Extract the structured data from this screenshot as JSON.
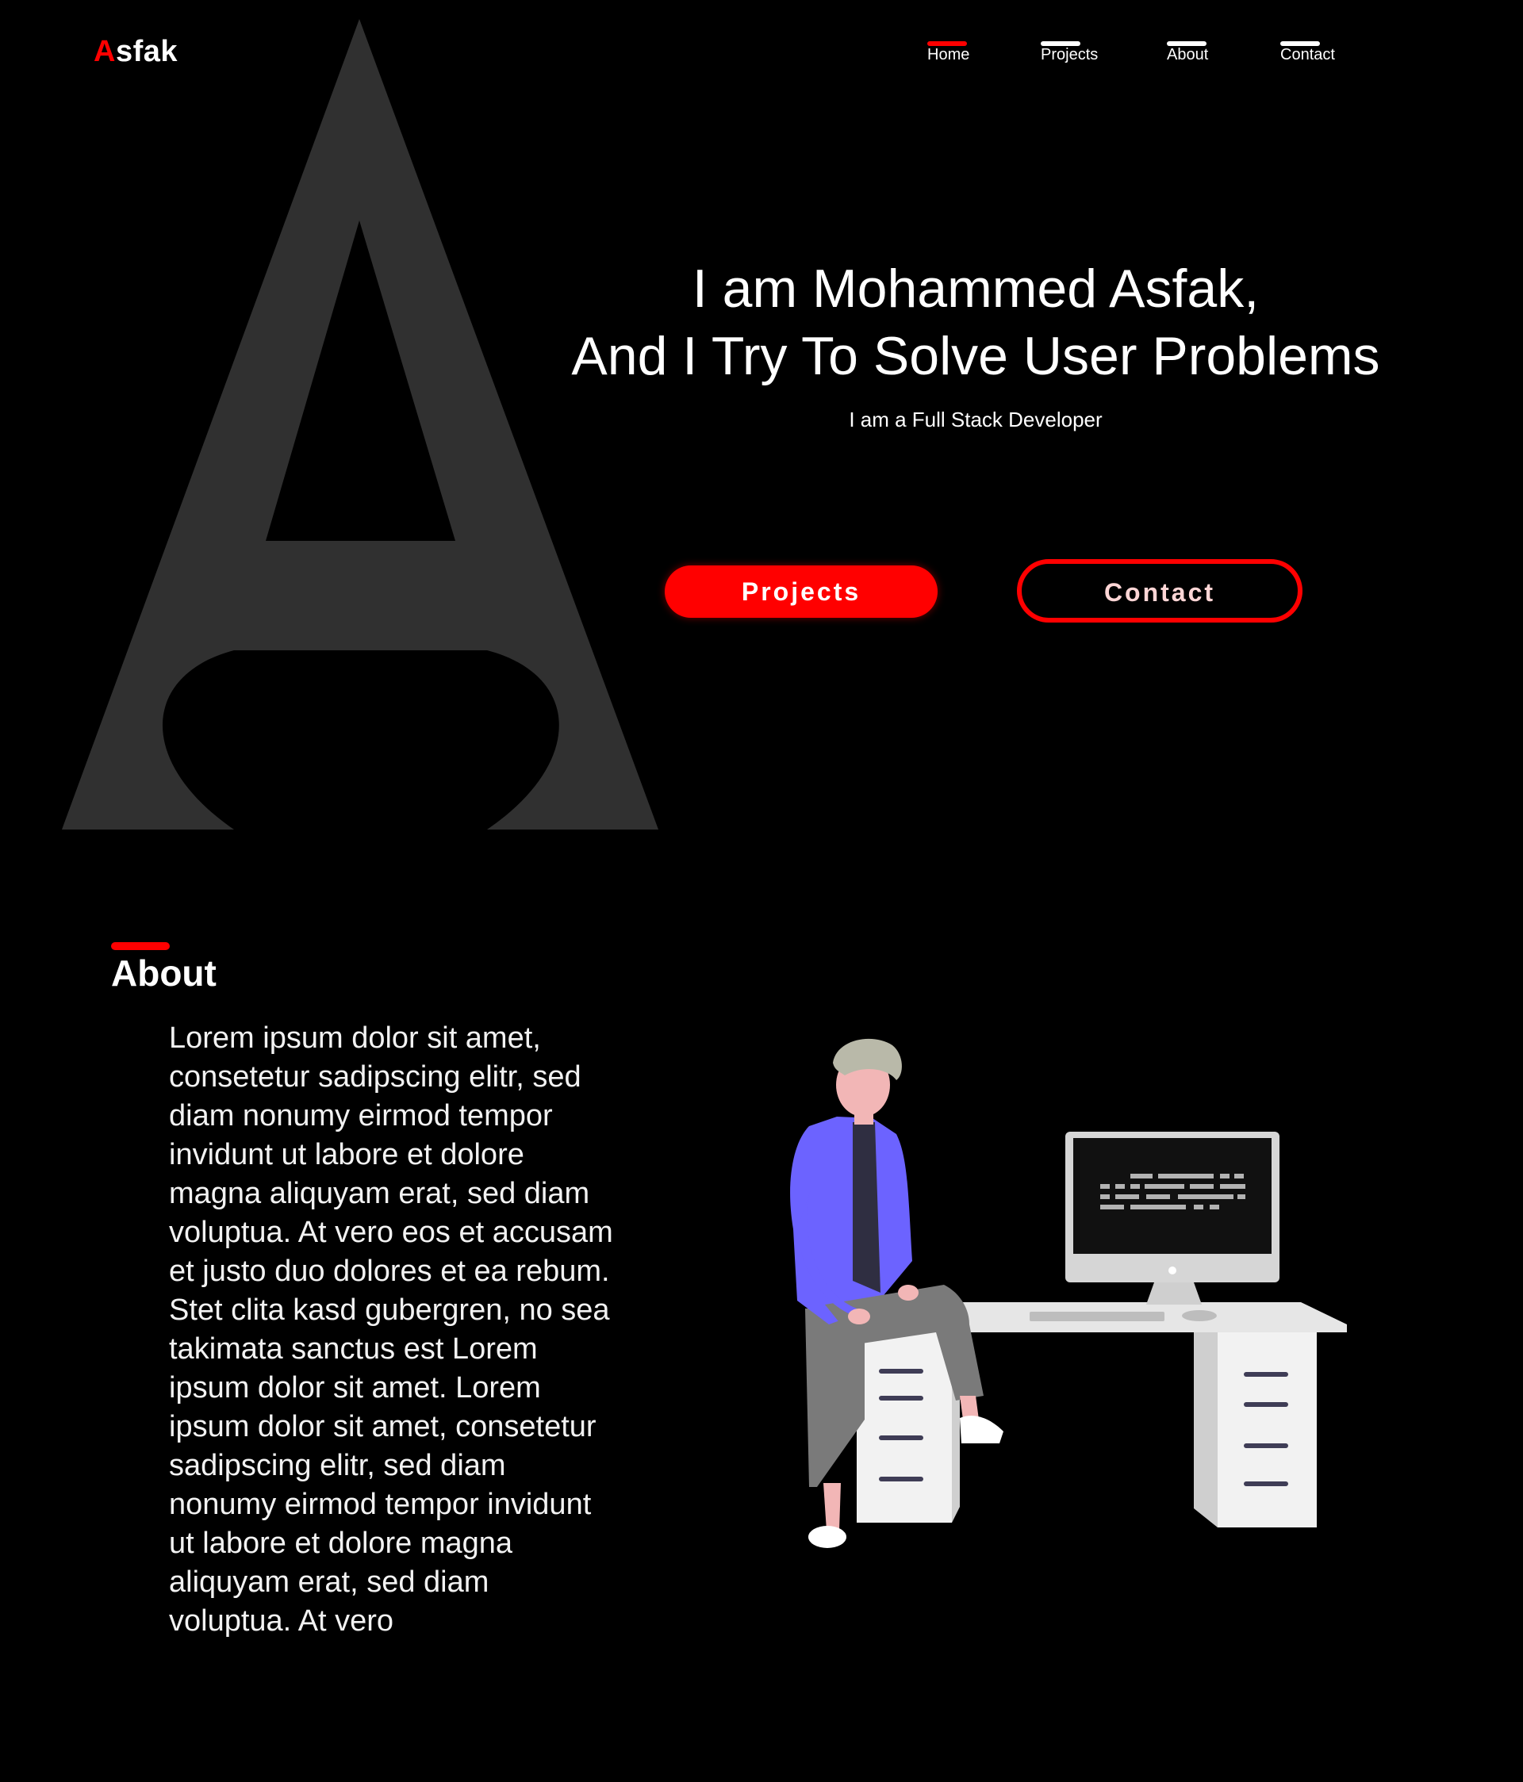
{
  "logo": {
    "accent": "A",
    "rest": "sfak"
  },
  "nav": {
    "items": [
      {
        "label": "Home",
        "active": true
      },
      {
        "label": "Projects",
        "active": false
      },
      {
        "label": "About",
        "active": false
      },
      {
        "label": "Contact",
        "active": false
      }
    ]
  },
  "hero": {
    "line1": "I am Mohammed Asfak,",
    "line2": "And I Try To Solve User Problems",
    "subtitle": "I am a Full Stack Developer",
    "projects_button": "Projects",
    "contact_button": "Contact"
  },
  "about": {
    "heading": "About",
    "body": "Lorem ipsum dolor sit amet, consetetur sadipscing elitr, sed diam nonumy eirmod tempor invidunt ut labore et dolore magna aliquyam erat, sed diam voluptua. At vero eos et accusam et justo duo dolores et ea rebum. Stet clita kasd gubergren, no sea takimata sanctus est Lorem ipsum dolor sit amet. Lorem ipsum dolor sit amet, consetetur sadipscing elitr, sed diam nonumy eirmod tempor invidunt ut labore et dolore magna aliquyam erat, sed diam voluptua. At vero"
  },
  "colors": {
    "background": "#000000",
    "accent": "#ff0000",
    "big_letter": "#303030",
    "text": "#ffffff",
    "jacket": "#6c63ff",
    "pants": "#777777",
    "desk": "#e0e0e0"
  },
  "icons": {
    "background_letter": "letter-a-shape",
    "illustration": "developer-at-desk-illustration"
  }
}
